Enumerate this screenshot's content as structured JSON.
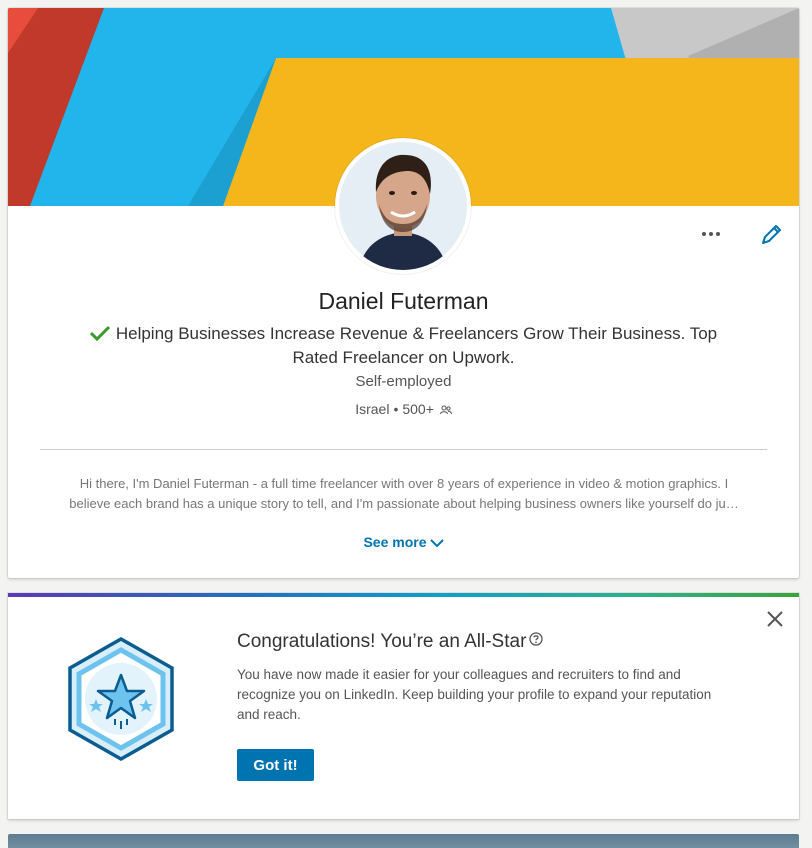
{
  "profile": {
    "name": "Daniel Futerman",
    "headline": "Helping Businesses Increase Revenue & Freelancers Grow Their Business. Top Rated Freelancer on Upwork.",
    "company": "Self-employed",
    "location": "Israel",
    "separator": "•",
    "connections": "500+",
    "summary_line1": "Hi there, I'm Daniel Futerman - a full time freelancer with over 8 years of experience in video & motion graphics. I",
    "summary_line2": "believe each brand has a unique story to tell, and I'm passionate about helping business owners like yourself do ju…",
    "see_more_label": "See more",
    "icons": [
      "more-horizontal-icon",
      "pencil-edit-icon",
      "checkmark-icon",
      "connections-icon",
      "chevron-down-icon"
    ]
  },
  "allstar": {
    "title": "Congratulations! You’re an All-Star",
    "body": "You have now made it easier for your colleagues and recruiters to find and recognize you on LinkedIn. Keep building your profile to expand your reputation and reach.",
    "button_label": "Got it!",
    "icons": [
      "help-circle-icon",
      "close-icon",
      "all-star-badge-icon"
    ]
  },
  "colors": {
    "brand": "#0073b1",
    "banner_red": "#c0392b",
    "banner_blue": "#22b5ec",
    "banner_yellow": "#f4b61b",
    "banner_gray": "#c8c8c8",
    "check_green": "#3a9a2b"
  }
}
